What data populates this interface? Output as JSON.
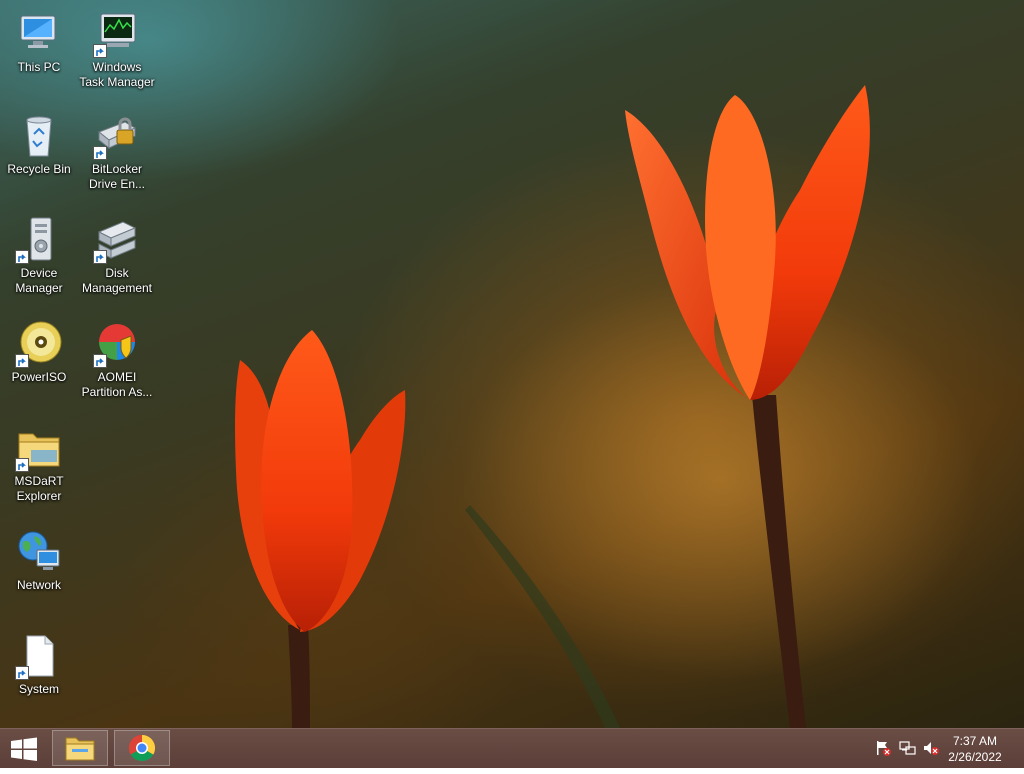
{
  "desktop": {
    "icons": [
      {
        "label": "This PC",
        "icon": "this-pc-icon"
      },
      {
        "label": "Windows\nTask Manager",
        "icon": "task-manager-icon"
      },
      {
        "label": "Recycle Bin",
        "icon": "recycle-bin-icon"
      },
      {
        "label": "BitLocker\nDrive En...",
        "icon": "bitlocker-icon"
      },
      {
        "label": "Device\nManager",
        "icon": "device-manager-icon"
      },
      {
        "label": "Disk\nManagement",
        "icon": "disk-management-icon"
      },
      {
        "label": "PowerISO",
        "icon": "poweriso-icon"
      },
      {
        "label": "AOMEI\nPartition As...",
        "icon": "aomei-icon"
      },
      {
        "label": "MSDaRT\nExplorer",
        "icon": "msdart-explorer-icon"
      },
      {
        "label": "Network",
        "icon": "network-icon"
      },
      {
        "label": "System",
        "icon": "system-file-icon"
      }
    ]
  },
  "taskbar": {
    "start_icon": "windows-logo-icon",
    "pinned": [
      {
        "name": "file-explorer",
        "icon": "folder-icon"
      },
      {
        "name": "google-chrome",
        "icon": "chrome-icon"
      }
    ],
    "tray": {
      "icons": [
        "action-center-flag-icon",
        "network-status-icon",
        "volume-muted-icon"
      ],
      "time": "7:37 AM",
      "date": "2/26/2022"
    }
  },
  "colors": {
    "taskbar": "#5b3f38",
    "tulip": "#ff4a12",
    "accent": "#1e6fbf"
  }
}
